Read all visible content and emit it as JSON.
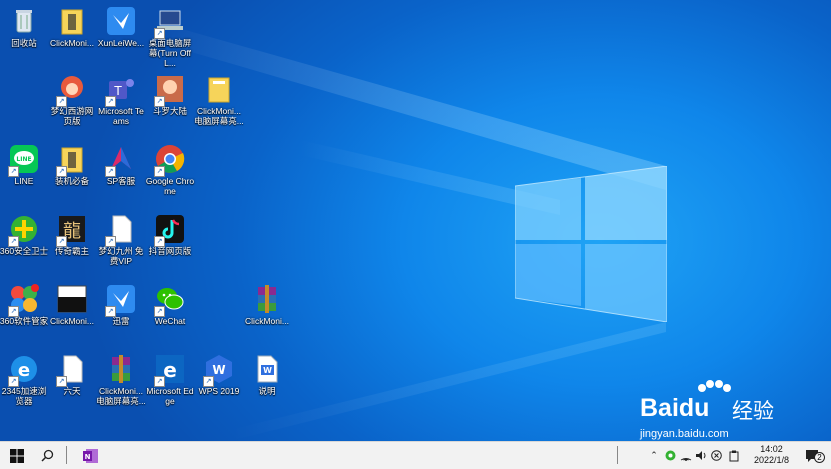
{
  "desktop_icons": [
    {
      "label": "回收站",
      "icon": "recycle-bin-icon"
    },
    {
      "label": "ClickMoni...",
      "icon": "folder-icon"
    },
    {
      "label": "XunLeiWe...",
      "icon": "xunlei-bird-icon"
    },
    {
      "label": "桌面电脑屏幕(Turn Off L...",
      "icon": "laptop-icon"
    },
    {
      "label": "梦幻西游网页版",
      "icon": "game-character-icon"
    },
    {
      "label": "Microsoft Teams",
      "icon": "teams-icon"
    },
    {
      "label": "斗罗大陆",
      "icon": "game-portrait-icon"
    },
    {
      "label": "ClickMoni... 电脑屏幕亮...",
      "icon": "folder-icon"
    },
    {
      "label": "LINE",
      "icon": "line-app-icon"
    },
    {
      "label": "装机必备",
      "icon": "folder-icon"
    },
    {
      "label": "SP客服",
      "icon": "sp-app-icon"
    },
    {
      "label": "Google Chrome",
      "icon": "chrome-icon"
    },
    {
      "label": "360安全卫士",
      "icon": "360-security-icon"
    },
    {
      "label": "传奇霸主",
      "icon": "dragon-game-icon"
    },
    {
      "label": "梦幻九州 免费VIP",
      "icon": "blank-file-icon"
    },
    {
      "label": "抖音网页版",
      "icon": "tiktok-icon"
    },
    {
      "label": "360软件管家",
      "icon": "360-software-icon"
    },
    {
      "label": "ClickMoni...",
      "icon": "monitor-window-icon"
    },
    {
      "label": "迅雷",
      "icon": "xunlei-bird-icon"
    },
    {
      "label": "WeChat",
      "icon": "wechat-icon"
    },
    {
      "label": "ClickMoni...",
      "icon": "winrar-icon"
    },
    {
      "label": "2345加速浏览器",
      "icon": "ie-browser-icon"
    },
    {
      "label": "六天",
      "icon": "blank-file-icon"
    },
    {
      "label": "ClickMoni... 电脑屏幕亮...",
      "icon": "winrar-icon"
    },
    {
      "label": "Microsoft Edge",
      "icon": "edge-icon"
    },
    {
      "label": "WPS 2019",
      "icon": "wps-icon"
    },
    {
      "label": "说明",
      "icon": "wps-doc-icon"
    }
  ],
  "taskbar": {
    "start": "windows-start-icon",
    "search": "search-icon",
    "pinned": "onenote-icon",
    "tray_icons": [
      "chevron-up-icon",
      "360-tray-icon",
      "network-icon",
      "volume-icon",
      "close-circle-icon",
      "clipboard-icon"
    ],
    "time": "14:02",
    "date": "2022/1/8",
    "notification_count": "2"
  },
  "watermark": {
    "brand": "Baidu",
    "cn": "经验",
    "url": "jingyan.baidu.com"
  },
  "colors": {
    "accent": "#0f86ea",
    "taskbar": "#f2f2f2"
  }
}
